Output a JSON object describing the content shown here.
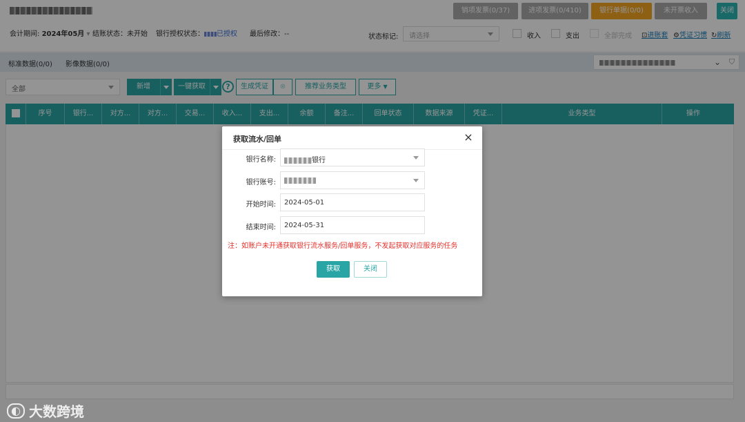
{
  "header": {
    "buttons": [
      {
        "label": "销项发票(0/37)"
      },
      {
        "label": "进项发票(0/410)"
      },
      {
        "label": "银行单据(0/0)"
      },
      {
        "label": "未开票收入"
      },
      {
        "label": "关闭"
      }
    ]
  },
  "info": {
    "period_label": "会计期间:",
    "period_value": "2024年05月",
    "close_status": "结账状态：未开始",
    "auth_label": "银行授权状态：",
    "auth_value": "已授权",
    "last_modified": "最后修改：--",
    "status_mark_label": "状态标记:",
    "status_mark_placeholder": "请选择",
    "income": "收入",
    "expense": "支出",
    "all_done": "全部完成",
    "links": [
      "进账套",
      "凭证习惯",
      "刷新"
    ]
  },
  "tabs": [
    "标准数据(0/0)",
    "影像数据(0/0)"
  ],
  "toolbar": {
    "filter_value": "全部",
    "add": "新增",
    "fetch": "一键获取",
    "gen_voucher": "生成凭证",
    "recommend": "推荐业务类型",
    "more": "更多"
  },
  "grid": {
    "columns": [
      "序号",
      "银行...",
      "对方...",
      "对方...",
      "交易...",
      "收入...",
      "支出...",
      "余额",
      "备注...",
      "回单状态",
      "数据来源",
      "凭证...",
      "业务类型",
      "操作"
    ]
  },
  "modal": {
    "title": "获取流水/回单",
    "bank_name_label": "银行名称:",
    "bank_name_suffix": "银行",
    "bank_account_label": "银行账号:",
    "start_label": "开始时间:",
    "start_value": "2024-05-01",
    "end_label": "结束时间:",
    "end_value": "2024-05-31",
    "note": "注：如账户未开通获取银行流水服务/回单服务，不发起获取对应服务的任务",
    "confirm": "获取",
    "cancel": "关闭"
  },
  "watermark": "大数跨境"
}
